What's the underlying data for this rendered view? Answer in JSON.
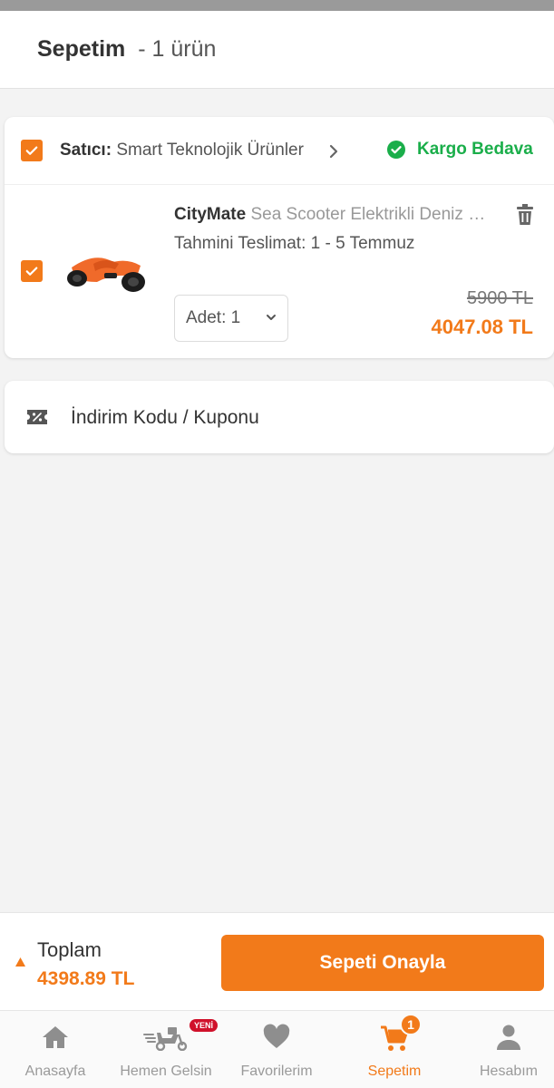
{
  "header": {
    "title": "Sepetim",
    "count": "- 1 ürün"
  },
  "seller": {
    "prefix": "Satıcı:",
    "name": "Smart Teknolojik Ürünler",
    "shipping": "Kargo Bedava",
    "checked": true
  },
  "product": {
    "brand": "CityMate",
    "name": "Sea Scooter Elektrikli Deniz Scooter",
    "delivery": "Tahmini Teslimat: 1 - 5 Temmuz",
    "quantity_label": "Adet: 1",
    "old_price": "5900 TL",
    "new_price": "4047.08 TL",
    "checked": true
  },
  "coupon": {
    "label": "İndirim Kodu / Kuponu"
  },
  "checkout": {
    "total_label": "Toplam",
    "total_value": "4398.89 TL",
    "confirm_label": "Sepeti Onayla"
  },
  "nav": {
    "items": [
      {
        "label": "Anasayfa",
        "icon": "home-icon"
      },
      {
        "label": "Hemen Gelsin",
        "icon": "scooter-icon",
        "badge": "YENİ"
      },
      {
        "label": "Favorilerim",
        "icon": "heart-icon"
      },
      {
        "label": "Sepetim",
        "icon": "cart-icon",
        "badge": "1",
        "active": true
      },
      {
        "label": "Hesabım",
        "icon": "user-icon"
      }
    ]
  },
  "colors": {
    "accent": "#f27a1a",
    "success": "#1aae4a",
    "badge_red": "#d0112b"
  }
}
